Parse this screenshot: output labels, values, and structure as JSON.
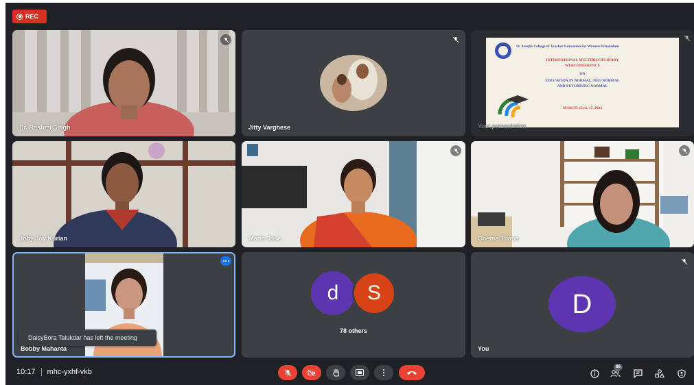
{
  "recording": {
    "label": "REC"
  },
  "participants": {
    "rashmi": {
      "name": "Dr. Rashmi Singh"
    },
    "jitty": {
      "name": "Jitty Varghese"
    },
    "presentation": {
      "label": "Your presentation",
      "slide": {
        "college": "St. Joseph College of Teacher Education for Women Ernakulam",
        "line1": "INTERNATIONAL MULTIDISCIPLINARY",
        "line2": "WEBCONFERENCE",
        "line3": "ON",
        "line4": "EDUCATION IN NORMAL, NEO NORMAL",
        "line5": "AND FUTURISTIC NORMAL",
        "dates": "MARCH 15,16, 17, 2022"
      }
    },
    "joby": {
      "name": "Joby Joy Kurian"
    },
    "marin": {
      "name": "Marin Jose"
    },
    "chetna": {
      "name": "Chetna Thapa"
    },
    "bobby": {
      "name": "Bobby Mahanta"
    },
    "others": {
      "avatar1": "d",
      "avatar2": "S",
      "label": "78 others"
    },
    "you": {
      "avatar": "D",
      "name": "You"
    }
  },
  "notification": {
    "text": "DaisyBora Talukdar has left the meeting"
  },
  "meeting": {
    "time": "10:17",
    "code": "mhc-yxhf-vkb"
  },
  "people_count": "86",
  "colors": {
    "background": "#202124",
    "tile": "#3c4043",
    "danger": "#ea4335",
    "avatar_purple": "#5e35b1",
    "avatar_orange": "#d84315",
    "active_border": "#8ab4f8"
  },
  "icons": {
    "controls": [
      "mic-off-icon",
      "camera-off-icon",
      "raise-hand-icon",
      "present-icon",
      "more-options-icon",
      "hangup-icon"
    ],
    "right": [
      "info-icon",
      "people-icon",
      "chat-icon",
      "activities-icon",
      "host-controls-icon"
    ]
  }
}
